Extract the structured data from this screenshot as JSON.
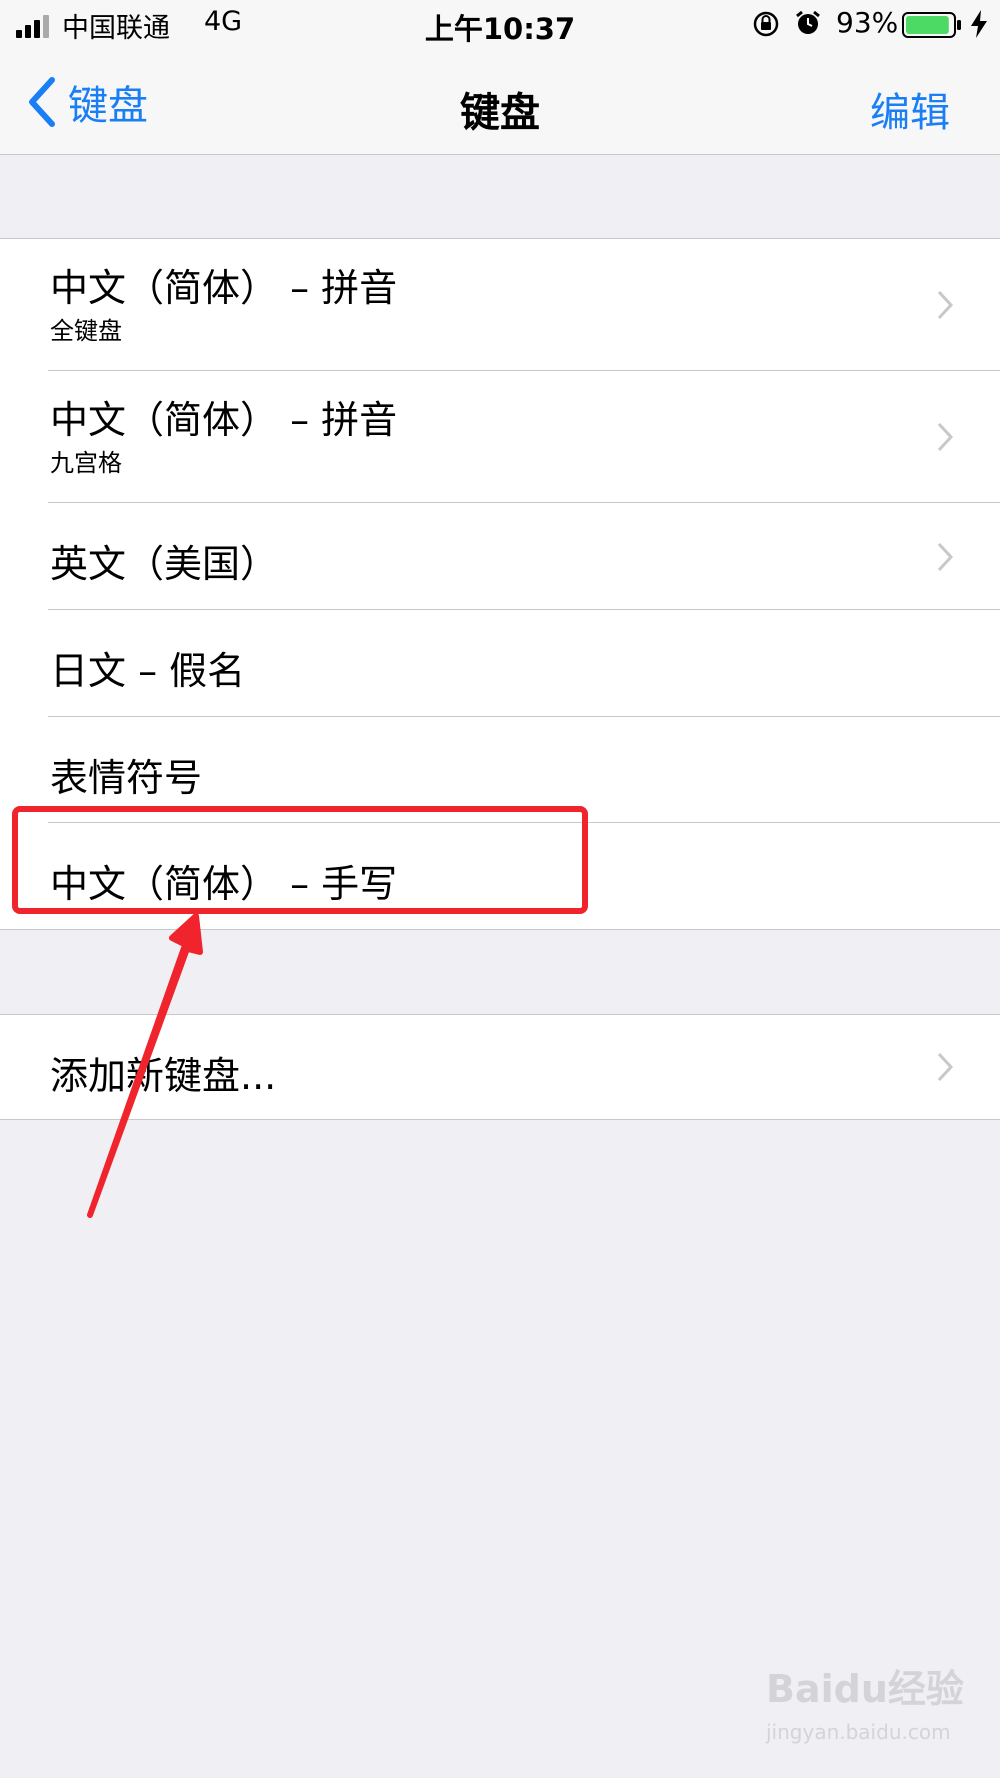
{
  "status_bar": {
    "carrier": "中国联通",
    "network": "4G",
    "time": "上午10:37",
    "battery": "93%",
    "icons": [
      "signal-icon",
      "orientation-lock-icon",
      "alarm-icon",
      "battery-icon",
      "charging-bolt-icon"
    ],
    "battery_level": 0.93,
    "battery_color": "#4cd964"
  },
  "nav": {
    "back_label": "键盘",
    "title": "键盘",
    "edit_label": "编辑",
    "accent_color": "#1a7ef5"
  },
  "keyboards": [
    {
      "label": "中文（简体） – 拼音",
      "sublabel": "全键盘",
      "chevron": true
    },
    {
      "label": "中文（简体） – 拼音",
      "sublabel": "九宫格",
      "chevron": true
    },
    {
      "label": "英文（美国）",
      "chevron": true
    },
    {
      "label": "日文 – 假名",
      "chevron": false
    },
    {
      "label": "表情符号",
      "chevron": false
    },
    {
      "label": "中文（简体） – 手写",
      "chevron": false
    }
  ],
  "add_keyboard": {
    "label": "添加新键盘...",
    "chevron": true
  },
  "annotation": {
    "color": "#f0242c",
    "highlighted_item": "中文（简体） – 手写"
  },
  "watermark": {
    "logo": "Baidu经验",
    "url": "jingyan.baidu.com"
  }
}
